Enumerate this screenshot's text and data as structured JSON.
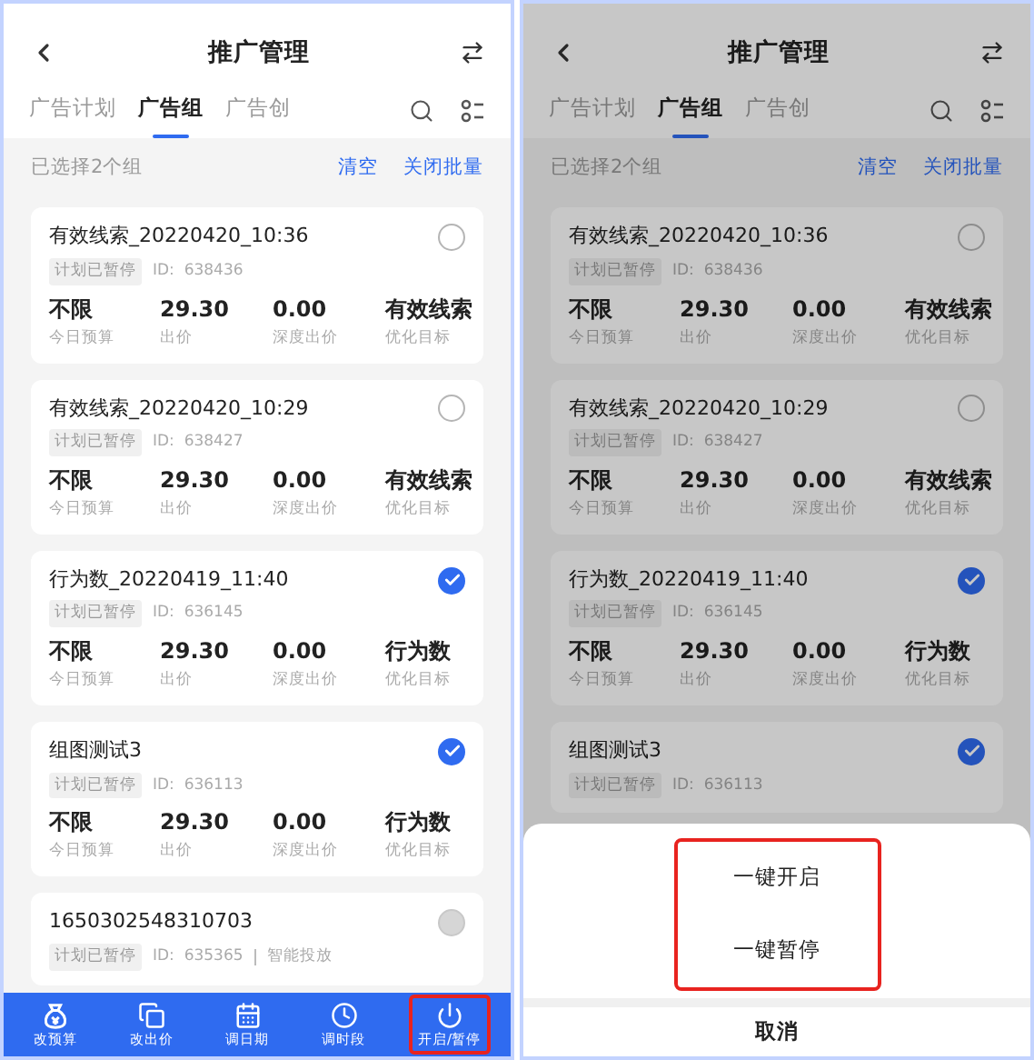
{
  "screens": [
    {
      "header": {
        "title": "推广管理"
      },
      "tabs": [
        {
          "label": "广告计划",
          "selected": false
        },
        {
          "label": "广告组",
          "selected": true
        },
        {
          "label": "广告创",
          "selected": false
        }
      ],
      "selection": {
        "summary": "已选择2个组",
        "actions": [
          "清空",
          "关闭批量"
        ]
      },
      "cards": [
        {
          "title": "有效线索_20220420_10:36",
          "tag": "计划已暂停",
          "id": "ID:  638436",
          "selected": false,
          "disabled": false,
          "metrics": [
            {
              "value": "不限",
              "label": "今日预算"
            },
            {
              "value": "29.30",
              "label": "出价"
            },
            {
              "value": "0.00",
              "label": "深度出价"
            },
            {
              "value": "有效线索",
              "label": "优化目标"
            }
          ]
        },
        {
          "title": "有效线索_20220420_10:29",
          "tag": "计划已暂停",
          "id": "ID:  638427",
          "selected": false,
          "disabled": false,
          "metrics": [
            {
              "value": "不限",
              "label": "今日预算"
            },
            {
              "value": "29.30",
              "label": "出价"
            },
            {
              "value": "0.00",
              "label": "深度出价"
            },
            {
              "value": "有效线索",
              "label": "优化目标"
            }
          ]
        },
        {
          "title": "行为数_20220419_11:40",
          "tag": "计划已暂停",
          "id": "ID:  636145",
          "selected": true,
          "disabled": false,
          "metrics": [
            {
              "value": "不限",
              "label": "今日预算"
            },
            {
              "value": "29.30",
              "label": "出价"
            },
            {
              "value": "0.00",
              "label": "深度出价"
            },
            {
              "value": "行为数",
              "label": "优化目标"
            }
          ]
        },
        {
          "title": "组图测试3",
          "tag": "计划已暂停",
          "id": "ID:  636113",
          "selected": true,
          "disabled": false,
          "metrics": [
            {
              "value": "不限",
              "label": "今日预算"
            },
            {
              "value": "29.30",
              "label": "出价"
            },
            {
              "value": "0.00",
              "label": "深度出价"
            },
            {
              "value": "行为数",
              "label": "优化目标"
            }
          ]
        },
        {
          "title": "1650302548310703",
          "tag": "计划已暂停",
          "id": "ID:  635365",
          "extra": "智能投放",
          "selected": false,
          "disabled": true
        }
      ],
      "toolbar": [
        {
          "kind": "budget",
          "label": "改预算",
          "highlighted": false
        },
        {
          "kind": "bid",
          "label": "改出价",
          "highlighted": false
        },
        {
          "kind": "date",
          "label": "调日期",
          "highlighted": false
        },
        {
          "kind": "time",
          "label": "调时段",
          "highlighted": false
        },
        {
          "kind": "power",
          "label": "开启/暂停",
          "highlighted": true
        }
      ]
    },
    {
      "header": {
        "title": "推广管理"
      },
      "tabs": [
        {
          "label": "广告计划",
          "selected": false
        },
        {
          "label": "广告组",
          "selected": true
        },
        {
          "label": "广告创",
          "selected": false
        }
      ],
      "selection": {
        "summary": "已选择2个组",
        "actions": [
          "清空",
          "关闭批量"
        ]
      },
      "cards": [
        {
          "title": "有效线索_20220420_10:36",
          "tag": "计划已暂停",
          "id": "ID:  638436",
          "selected": false,
          "disabled": false,
          "metrics": [
            {
              "value": "不限",
              "label": "今日预算"
            },
            {
              "value": "29.30",
              "label": "出价"
            },
            {
              "value": "0.00",
              "label": "深度出价"
            },
            {
              "value": "有效线索",
              "label": "优化目标"
            }
          ]
        },
        {
          "title": "有效线索_20220420_10:29",
          "tag": "计划已暂停",
          "id": "ID:  638427",
          "selected": false,
          "disabled": false,
          "metrics": [
            {
              "value": "不限",
              "label": "今日预算"
            },
            {
              "value": "29.30",
              "label": "出价"
            },
            {
              "value": "0.00",
              "label": "深度出价"
            },
            {
              "value": "有效线索",
              "label": "优化目标"
            }
          ]
        },
        {
          "title": "行为数_20220419_11:40",
          "tag": "计划已暂停",
          "id": "ID:  636145",
          "selected": true,
          "disabled": false,
          "metrics": [
            {
              "value": "不限",
              "label": "今日预算"
            },
            {
              "value": "29.30",
              "label": "出价"
            },
            {
              "value": "0.00",
              "label": "深度出价"
            },
            {
              "value": "行为数",
              "label": "优化目标"
            }
          ]
        },
        {
          "title": "组图测试3",
          "tag": "计划已暂停",
          "id": "ID:  636113",
          "selected": true,
          "disabled": false
        }
      ],
      "sheet": {
        "options": [
          "一键开启",
          "一键暂停"
        ],
        "highlighted": true,
        "cancel": "取消"
      }
    }
  ]
}
